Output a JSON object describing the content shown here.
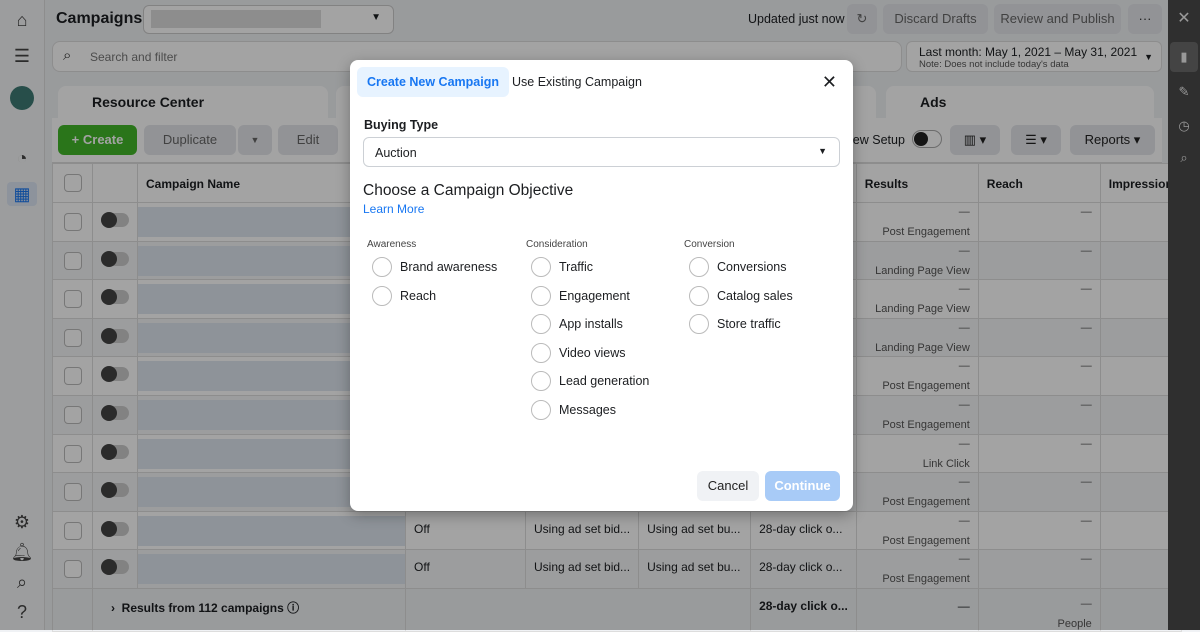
{
  "header": {
    "title": "Campaigns",
    "updated": "Updated just now",
    "discard": "Discard Drafts",
    "review": "Review and Publish",
    "more": "···"
  },
  "search": {
    "placeholder": "Search and filter"
  },
  "date": {
    "range": "Last month: May 1, 2021 – May 31, 2021",
    "note": "Note: Does not include today's data"
  },
  "tabs": {
    "resource": "Resource Center",
    "ads": "Ads"
  },
  "toolbar": {
    "create": "Create",
    "duplicate": "Duplicate",
    "edit": "Edit",
    "view_setup": "iew Setup",
    "reports": "Reports"
  },
  "table": {
    "headers": {
      "name": "Campaign Name",
      "results": "Results",
      "reach": "Reach",
      "impressions": "Impression"
    },
    "rows": [
      {
        "delivery": "",
        "bid": "",
        "budget": "",
        "attr": "",
        "results": "—",
        "rtype": "Post Engagement",
        "reach": "—"
      },
      {
        "delivery": "",
        "bid": "",
        "budget": "",
        "attr": "",
        "results": "—",
        "rtype": "Landing Page View",
        "reach": "—"
      },
      {
        "delivery": "",
        "bid": "",
        "budget": "",
        "attr": "",
        "results": "—",
        "rtype": "Landing Page View",
        "reach": "—"
      },
      {
        "delivery": "",
        "bid": "",
        "budget": "",
        "attr": "",
        "results": "—",
        "rtype": "Landing Page View",
        "reach": "—"
      },
      {
        "delivery": "",
        "bid": "",
        "budget": "",
        "attr": "",
        "results": "—",
        "rtype": "Post Engagement",
        "reach": "—"
      },
      {
        "delivery": "",
        "bid": "",
        "budget": "",
        "attr": "",
        "results": "—",
        "rtype": "Post Engagement",
        "reach": "—"
      },
      {
        "delivery": "",
        "bid": "",
        "budget": "",
        "attr": "",
        "results": "—",
        "rtype": "Link Click",
        "reach": "—"
      },
      {
        "delivery": "",
        "bid": "",
        "budget": "",
        "attr": "",
        "results": "—",
        "rtype": "Post Engagement",
        "reach": "—"
      },
      {
        "delivery": "Off",
        "bid": "Using ad set bid...",
        "budget": "Using ad set bu...",
        "attr": "28-day click o...",
        "results": "—",
        "rtype": "Post Engagement",
        "reach": "—"
      },
      {
        "delivery": "Off",
        "bid": "Using ad set bid...",
        "budget": "Using ad set bu...",
        "attr": "28-day click o...",
        "results": "—",
        "rtype": "Post Engagement",
        "reach": "—"
      }
    ],
    "footer": {
      "label": "Results from 112 campaigns",
      "attr": "28-day click o...",
      "results": "—",
      "reach": "—",
      "reach_unit": "People"
    }
  },
  "modal": {
    "tab_new": "Create New Campaign",
    "tab_existing": "Use Existing Campaign",
    "buying_type_label": "Buying Type",
    "buying_type": "Auction",
    "heading": "Choose a Campaign Objective",
    "learn_more": "Learn More",
    "groups": [
      {
        "label": "Awareness",
        "options": [
          "Brand awareness",
          "Reach"
        ]
      },
      {
        "label": "Consideration",
        "options": [
          "Traffic",
          "Engagement",
          "App installs",
          "Video views",
          "Lead generation",
          "Messages"
        ]
      },
      {
        "label": "Conversion",
        "options": [
          "Conversions",
          "Catalog sales",
          "Store traffic"
        ]
      }
    ],
    "cancel": "Cancel",
    "continue": "Continue"
  },
  "colors": {
    "accent": "#1877f2",
    "create_green": "#42b72a",
    "continue_disabled": "#a8cbf7"
  }
}
